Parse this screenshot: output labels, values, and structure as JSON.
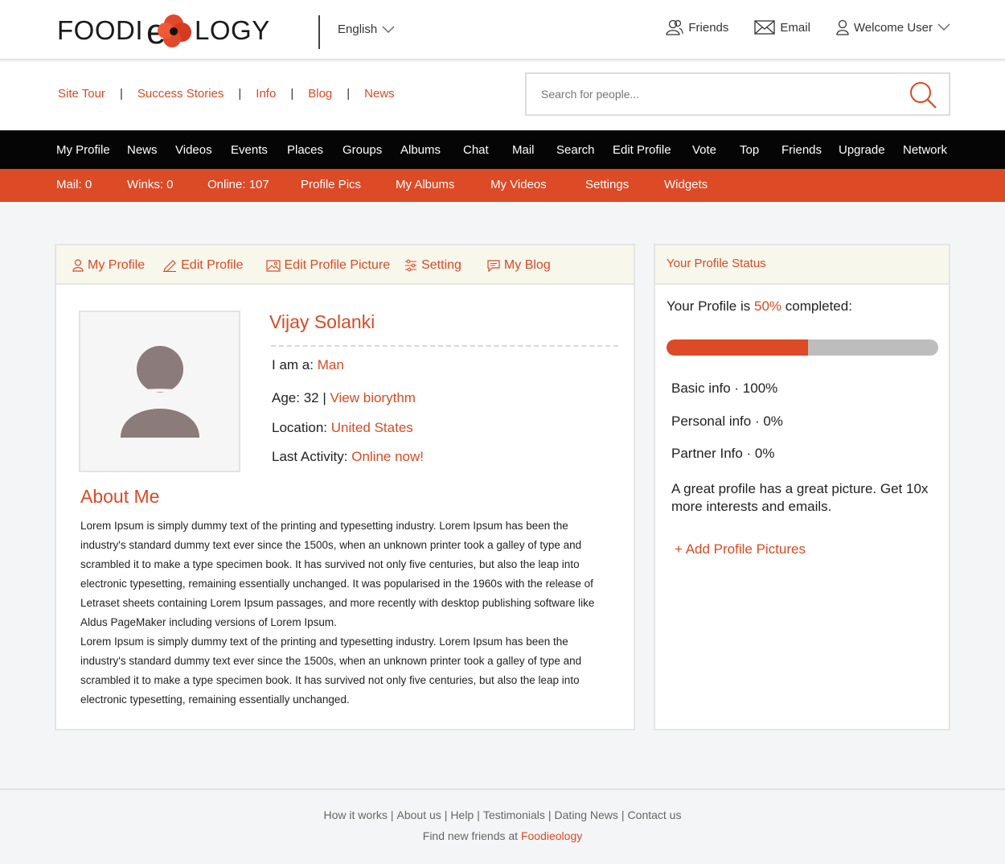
{
  "brand": {
    "logo_left": "FOODI",
    "logo_e": "e",
    "logo_right": "LOGY"
  },
  "top": {
    "language": "English",
    "friends": "Friends",
    "email": "Email",
    "welcome": "Welcome User"
  },
  "sublinks": [
    "Site Tour",
    "Success Stories",
    "Info",
    "Blog",
    "News"
  ],
  "search": {
    "placeholder": "Search for people..."
  },
  "nav_main": [
    "My Profile",
    "News",
    "Videos",
    "Events",
    "Places",
    "Groups",
    "Albums",
    "Chat",
    "Mail",
    "Search",
    "Edit Profile",
    "Vote",
    "Top",
    "Friends",
    "Upgrade",
    "Network"
  ],
  "nav_sub": [
    "Mail: 0",
    "Winks: 0",
    "Online: 107",
    "Profile Pics",
    "My Albums",
    "My Videos",
    "Settings",
    "Widgets"
  ],
  "profile_tabs": [
    "My Profile",
    "Edit Profile",
    "Edit Profile Picture",
    "Setting",
    "My Blog"
  ],
  "profile": {
    "name": "Vijay Solanki",
    "iam_label": "I am a:",
    "iam_value": "Man",
    "age_label": "Age: 32 |",
    "age_link": "View biorythm",
    "location_label": "Location:",
    "location_value": "United States",
    "activity_label": "Last Activity:",
    "activity_value": "Online now!"
  },
  "about": {
    "heading": "About Me",
    "paragraphs": [
      "Lorem Ipsum is simply dummy text of the printing and typesetting industry. Lorem Ipsum has been the industry's standard dummy text ever since the 1500s, when an unknown printer took a galley of type and scrambled it to make a type specimen book. It has survived not only five centuries, but also the leap into electronic typesetting, remaining essentially unchanged. It was popularised in the 1960s with the release of Letraset sheets containing Lorem Ipsum passages, and more recently with desktop publishing software like Aldus PageMaker including versions of Lorem Ipsum.",
      "Lorem Ipsum is simply dummy text of the printing and typesetting industry. Lorem Ipsum has been the industry's standard dummy text ever since the 1500s, when an unknown printer took a galley of type and scrambled it to make a type specimen book. It has survived not only five centuries, but also the leap into electronic typesetting, remaining essentially unchanged."
    ]
  },
  "status": {
    "heading": "Your Profile Status",
    "line_prefix": "Your Profile is",
    "percent": "50%",
    "line_suffix": "completed:",
    "progress": 0.52,
    "rows": [
      "Basic info · 100%",
      "Personal info · 0%",
      "Partner Info · 0%"
    ],
    "tip": "A great profile has a great picture. Get 10x more interests and emails.",
    "add_link": "+ Add Profile Pictures"
  },
  "footer": {
    "links": [
      "How it works",
      "About us",
      "Help",
      "Testimonials",
      "Dating News",
      "Contact us"
    ],
    "tagline": "Find new friends at",
    "brand_link": "Foodieology"
  },
  "colors": {
    "accent": "#dc4a26",
    "nav_dark": "#050505",
    "panel_head": "#f8f7ec"
  }
}
